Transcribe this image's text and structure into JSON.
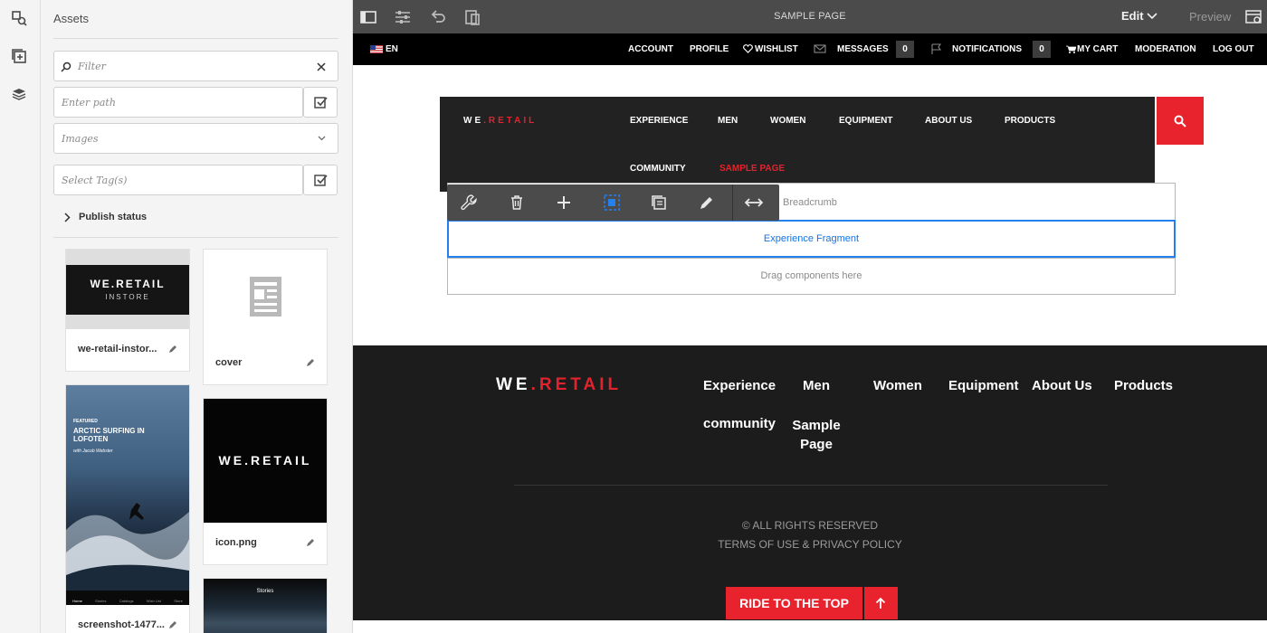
{
  "panel": {
    "title": "Assets",
    "filter_placeholder": "Filter",
    "path_placeholder": "Enter path",
    "type_value": "Images",
    "tags_placeholder": "Select Tag(s)",
    "publish_status": "Publish status",
    "assets": [
      {
        "name": "we-retail-instor...",
        "thumb_text_1": "WE.RETAIL",
        "thumb_text_2": "INSTORE"
      },
      {
        "name": "cover"
      },
      {
        "name": "icon.png",
        "thumb_text_1": "WE.RETAIL"
      },
      {
        "name": "screenshot-1477...",
        "thumb_kicker": "FEATURED",
        "thumb_title": "ARCTIC SURFING IN LOFOTEN",
        "thumb_byline": "with Jacob Webster",
        "thumb_tabs": [
          "Home",
          "Stories",
          "Catalogs",
          "Wish List",
          "Store"
        ]
      },
      {
        "thumb_text_1": "Stories"
      }
    ]
  },
  "toolbar": {
    "title": "SAMPLE PAGE",
    "mode": "Edit",
    "preview": "Preview"
  },
  "site_header": {
    "lang": "EN",
    "account": "ACCOUNT",
    "profile": "PROFILE",
    "wishlist": "WISHLIST",
    "messages": "MESSAGES",
    "messages_count": "0",
    "notifications": "NOTIFICATIONS",
    "notifications_count": "0",
    "cart": "MY CART",
    "moderation": "MODERATION",
    "logout": "LOG OUT"
  },
  "site_nav": {
    "logo_a": "WE",
    "logo_b": ".",
    "logo_c": "RETAIL",
    "items": [
      "EXPERIENCE",
      "MEN",
      "WOMEN",
      "EQUIPMENT",
      "ABOUT US",
      "PRODUCTS",
      "COMMUNITY",
      "SAMPLE PAGE"
    ]
  },
  "components": {
    "breadcrumb": "Breadcrumb",
    "fragment": "Experience Fragment",
    "drop": "Drag components here"
  },
  "footer": {
    "logo_a": "WE",
    "logo_b": ".",
    "logo_c": "RETAIL",
    "items": [
      "Experience",
      "Men",
      "Women",
      "Equipment",
      "About Us",
      "Products",
      "community",
      "Sample Page"
    ],
    "rights": "© ALL RIGHTS RESERVED",
    "terms": "TERMS OF USE & PRIVACY POLICY",
    "ride": "RIDE TO THE TOP"
  },
  "colors": {
    "brand_red": "#e8232e",
    "selection_blue": "#2680eb",
    "toolbar_gray": "#4b4b4b"
  }
}
